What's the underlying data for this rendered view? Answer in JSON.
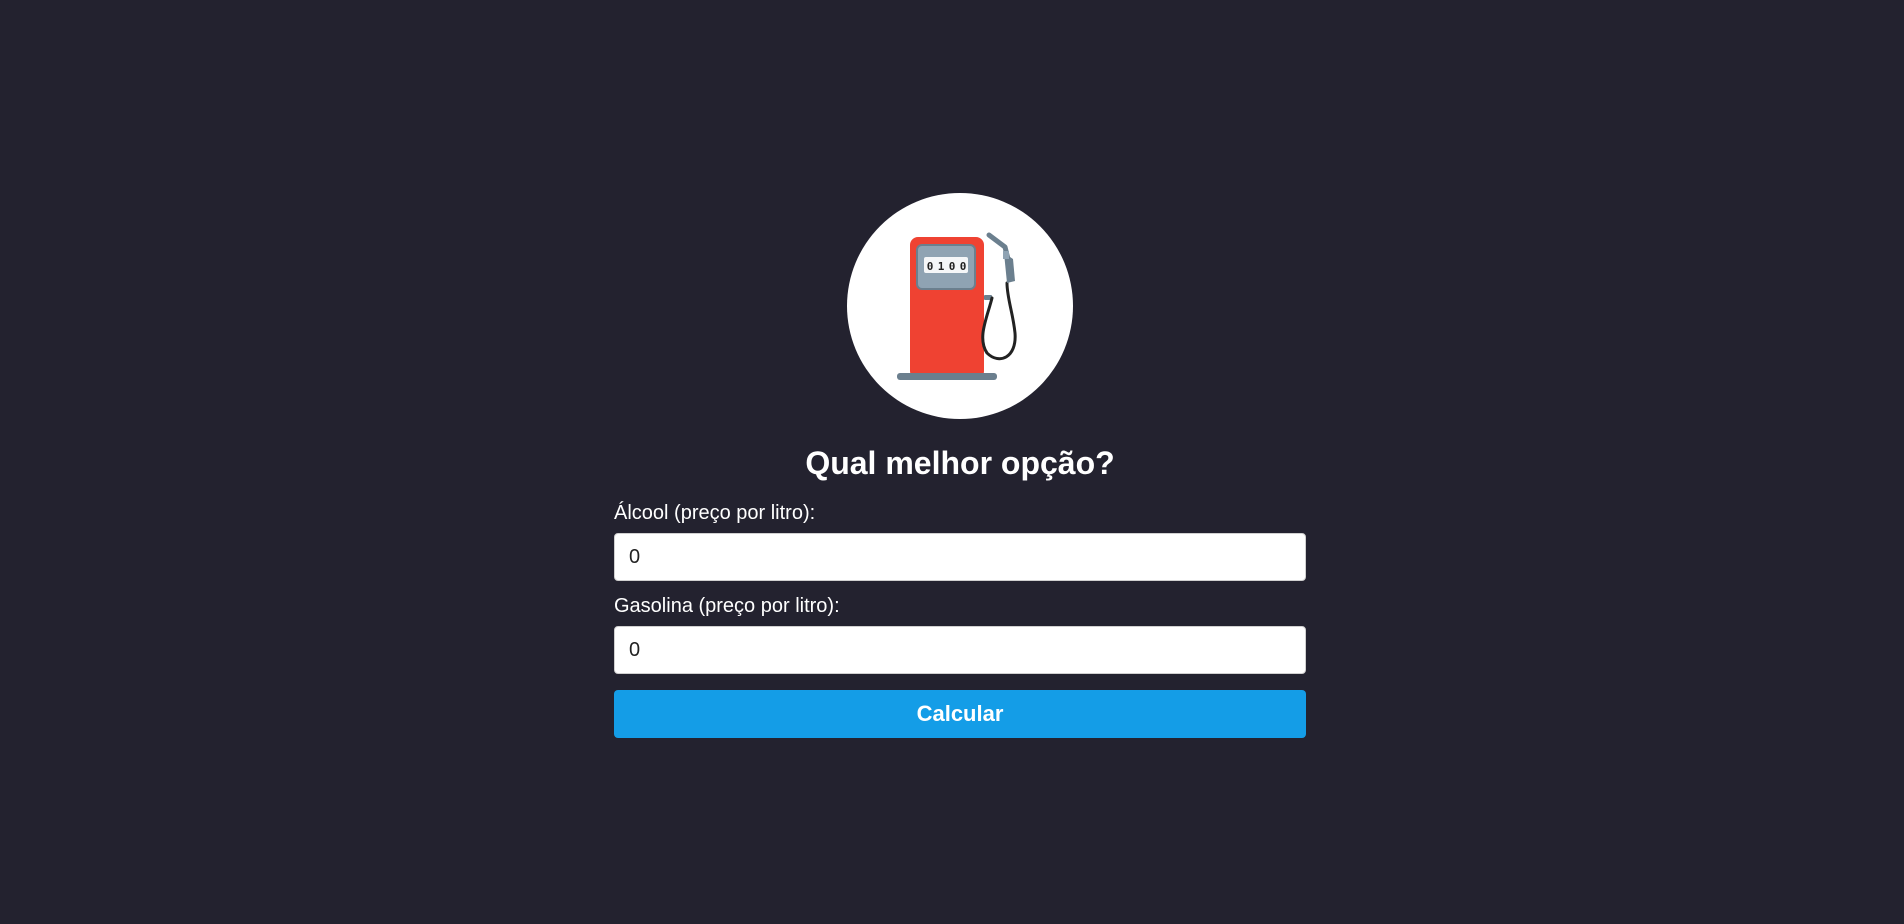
{
  "form": {
    "logo_icon": "fuel-pump-icon",
    "pump_display_digits": [
      "0",
      "1",
      "0",
      "0"
    ],
    "title": "Qual melhor opção?",
    "alcool_label": "Álcool (preço por litro):",
    "alcool_value": "0",
    "gasolina_label": "Gasolina (preço por litro):",
    "gasolina_value": "0",
    "submit_label": "Calcular"
  },
  "colors": {
    "background": "#23222f",
    "pump_body": "#ef4232",
    "pump_panel": "#8fa3b3",
    "pump_base": "#6b7f8e",
    "button": "#149de7"
  }
}
